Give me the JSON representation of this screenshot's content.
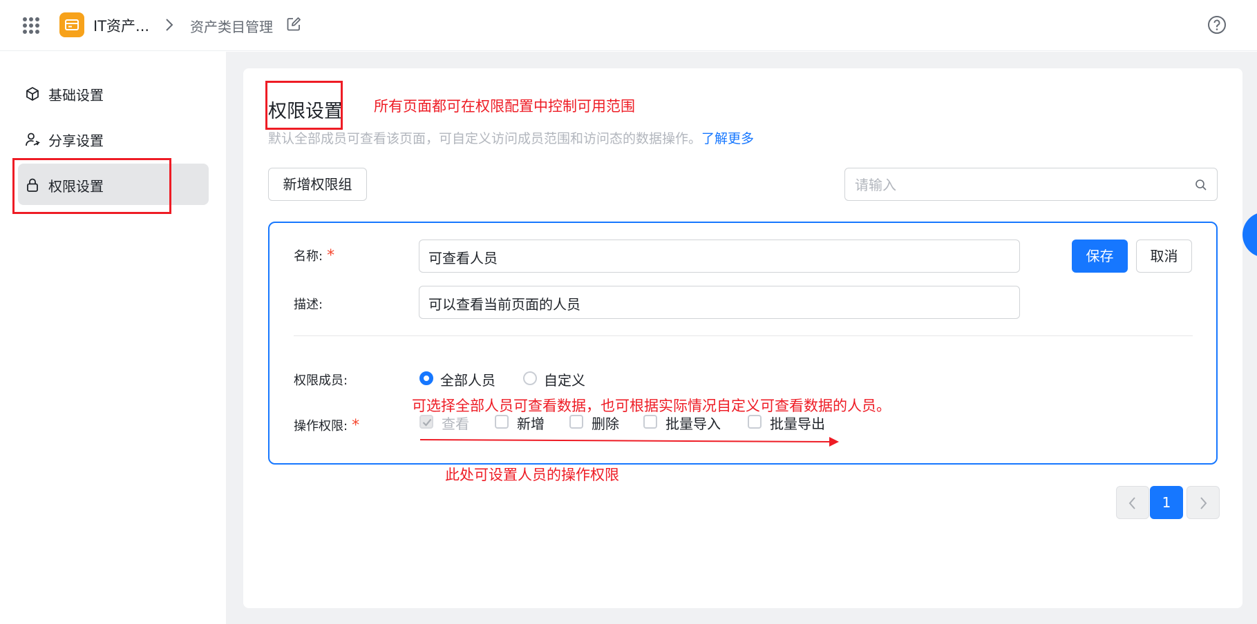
{
  "header": {
    "app_name": "IT资产...",
    "page_name": "资产类目管理",
    "icons": [
      "apps-grid-icon",
      "app-logo-icon",
      "chevron-right-icon",
      "edit-icon",
      "help-icon"
    ]
  },
  "sidebar": {
    "items": [
      {
        "label": "基础设置",
        "icon": "cube-icon"
      },
      {
        "label": "分享设置",
        "icon": "share-user-icon"
      },
      {
        "label": "权限设置",
        "icon": "lock-icon",
        "active": true
      }
    ]
  },
  "main": {
    "title": "权限设置",
    "description": "默认全部成员可查看该页面，可自定义访问成员范围和访问态的数据操作。",
    "learn_more": "了解更多",
    "add_group_button": "新增权限组",
    "search_placeholder": "请输入"
  },
  "form": {
    "name_label": "名称:",
    "name_value": "可查看人员",
    "desc_label": "描述:",
    "desc_value": "可以查看当前页面的人员",
    "required_mark": "*",
    "save_button": "保存",
    "cancel_button": "取消",
    "members_label": "权限成员:",
    "members_options": [
      "全部人员",
      "自定义"
    ],
    "members_selected": "全部人员",
    "ops_label": "操作权限:",
    "ops_options": [
      "查看",
      "新增",
      "删除",
      "批量导入",
      "批量导出"
    ],
    "ops_checked": [
      "查看"
    ]
  },
  "pagination": {
    "current_page": "1"
  },
  "annotations": {
    "title_note": "所有页面都可在权限配置中控制可用范围",
    "members_note": "可选择全部人员可查看数据，也可根据实际情况自定义可查看数据的人员。",
    "ops_note": "此处可设置人员的操作权限"
  },
  "colors": {
    "accent": "#1677ff",
    "annotation_red": "#ee1c25",
    "logo_orange": "#f7a21b",
    "required_red": "#f5462e"
  }
}
